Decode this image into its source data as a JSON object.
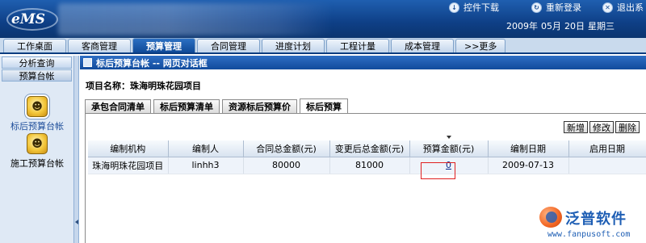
{
  "header": {
    "logo_text": "eMS",
    "links": [
      {
        "label": "控件下载",
        "icon": "download-icon"
      },
      {
        "label": "重新登录",
        "icon": "relogin-icon"
      },
      {
        "label": "退出系",
        "icon": "exit-icon"
      }
    ],
    "date": {
      "year": "2009年",
      "month": "05月",
      "day": "20日",
      "weekday": "星期三"
    }
  },
  "nav": {
    "tabs": [
      "工作桌面",
      "客商管理",
      "预算管理",
      "合同管理",
      "进度计划",
      "工程计量",
      "成本管理"
    ],
    "active_index": 2,
    "more": ">>更多"
  },
  "sidebar": {
    "sections": [
      "分析查询",
      "预算台帐"
    ],
    "items": [
      {
        "label": "标后预算台帐",
        "icon": "ledger-icon",
        "selected": true
      },
      {
        "label": "施工预算台帐",
        "icon": "ledger-icon",
        "selected": false
      }
    ]
  },
  "dialog": {
    "title": "标后预算台帐 -- 网页对话框",
    "project_label": "项目名称：",
    "project_name": "珠海明珠花园项目",
    "sub_tabs": [
      "承包合同清单",
      "标后预算清单",
      "资源标后预算价",
      "标后预算"
    ],
    "active_sub_tab": 3,
    "buttons": {
      "add": "新增",
      "edit": "修改",
      "delete": "删除"
    }
  },
  "grid": {
    "columns": [
      "编制机构",
      "编制人",
      "合同总金额(元)",
      "变更后总金额(元)",
      "预算金额(元)",
      "编制日期",
      "启用日期"
    ],
    "rows": [
      [
        "珠海明珠花园项目",
        "linhh3",
        "80000",
        "81000",
        "0",
        "2009-07-13",
        ""
      ]
    ]
  },
  "watermark": {
    "name": "泛普软件",
    "url": "www.fanpusoft.com"
  }
}
